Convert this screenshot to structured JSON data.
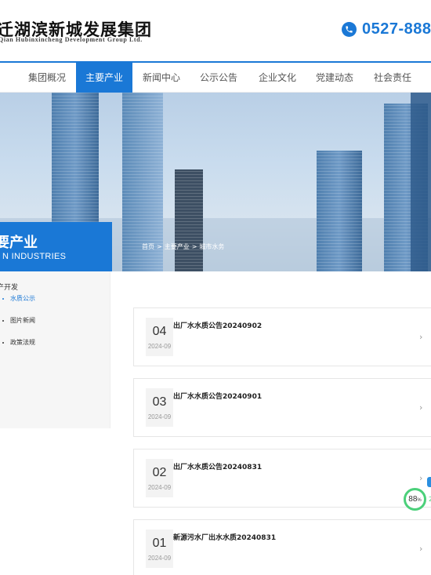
{
  "header": {
    "logo_cn": "迁湖滨新城发展集团",
    "logo_en": "Qian Hubinxincheng Development Group Ltd.",
    "phone": "0527-888"
  },
  "nav": {
    "items": [
      {
        "label": "集团概况"
      },
      {
        "label": "主要产业"
      },
      {
        "label": "新闻中心"
      },
      {
        "label": "公示公告"
      },
      {
        "label": "企业文化"
      },
      {
        "label": "党建动态"
      },
      {
        "label": "社会责任"
      }
    ],
    "active_index": 1
  },
  "banner": {
    "title": "要产业",
    "subtitle": "N INDUSTRIES",
    "breadcrumb": [
      "首页",
      ">",
      "主要产业",
      ">",
      "城市水务"
    ]
  },
  "sidebar": {
    "heading": "产开发",
    "items": [
      {
        "label": "水质公示",
        "active": true
      },
      {
        "label": "图片新闻",
        "active": false
      },
      {
        "label": "政策法规",
        "active": false
      }
    ]
  },
  "list": {
    "items": [
      {
        "day": "04",
        "ym": "2024-09",
        "title": "出厂水水质公告20240902"
      },
      {
        "day": "03",
        "ym": "2024-09",
        "title": "出厂水水质公告20240901"
      },
      {
        "day": "02",
        "ym": "2024-09",
        "title": "出厂水水质公告20240831"
      },
      {
        "day": "01",
        "ym": "2024-09",
        "title": "新源污水厂出水水质20240831"
      }
    ],
    "arrow": "›"
  },
  "widget": {
    "score": "88",
    "unit": "%",
    "side": "2"
  },
  "colors": {
    "primary": "#1a78d6",
    "ring": "#4bd07a"
  },
  "icons": [
    "phone-icon",
    "chevron-right-icon"
  ]
}
